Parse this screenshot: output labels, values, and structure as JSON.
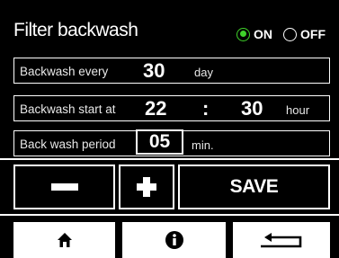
{
  "header": {
    "title": "Filter backwash",
    "on_label": "ON",
    "off_label": "OFF",
    "selected": "ON"
  },
  "settings": {
    "every": {
      "label": "Backwash every",
      "value": "30",
      "unit": "day"
    },
    "start": {
      "label": "Backwash start at",
      "hour": "22",
      "separator": ":",
      "minute": "30",
      "unit": "hour"
    },
    "period": {
      "label": "Back wash period",
      "value": "05",
      "unit": "min."
    }
  },
  "controls": {
    "minus_icon": "minus-icon",
    "plus_icon": "plus-icon",
    "save_label": "SAVE"
  },
  "nav": {
    "home_icon": "home-icon",
    "info_icon": "info-icon",
    "back_icon": "return-arrow-icon"
  },
  "colors": {
    "background": "#000000",
    "foreground": "#ffffff",
    "accent_on": "#3fd22a"
  }
}
